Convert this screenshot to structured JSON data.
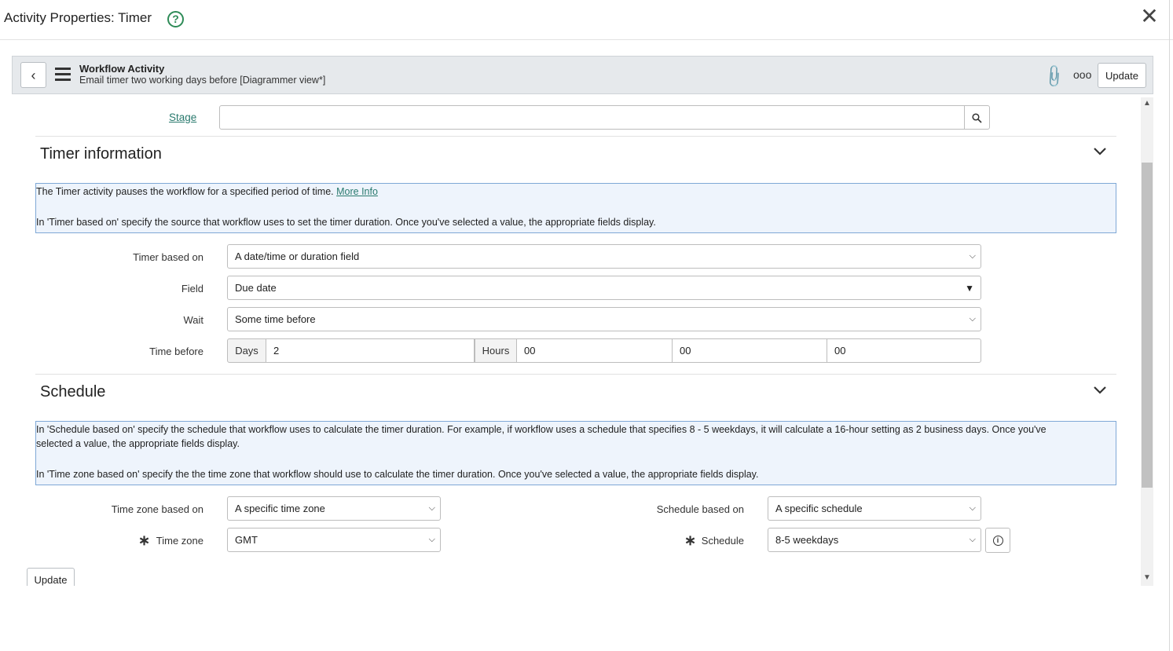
{
  "dialog": {
    "title": "Activity Properties: Timer",
    "help_symbol": "?",
    "close_symbol": "✕"
  },
  "header": {
    "back_symbol": "‹",
    "title": "Workflow Activity",
    "subtitle": "Email timer two working days before [Diagrammer view*]",
    "attach_symbol": "📎",
    "more_symbol": "ooo",
    "update_label": "Update"
  },
  "stage": {
    "label": "Stage",
    "value": "",
    "search_symbol": "🔍"
  },
  "timer": {
    "section_title": "Timer information",
    "info_line1": "The Timer activity pauses the workflow for a specified period of time.",
    "info_link": "More Info",
    "info_line2": "In 'Timer based on' specify the source that workflow uses to set the timer duration. Once you've selected a value, the appropriate fields display.",
    "timer_based_on_label": "Timer based on",
    "timer_based_on_value": "A date/time or duration field",
    "field_label": "Field",
    "field_value": "Due date",
    "wait_label": "Wait",
    "wait_value": "Some time before",
    "time_before_label": "Time before",
    "days_label": "Days",
    "days_value": "2",
    "hours_label": "Hours",
    "hours_value": "00",
    "minutes_value": "00",
    "seconds_value": "00"
  },
  "schedule": {
    "section_title": "Schedule",
    "info_line1": "In 'Schedule based on' specify the schedule that workflow uses to calculate the timer duration. For example, if workflow uses a schedule that specifies 8 - 5 weekdays, it will calculate a 16-hour setting as 2 business days. Once you've",
    "info_line1b": "selected a value, the appropriate fields display.",
    "info_line2": "In 'Time zone based on' specify the the time zone that workflow should use to calculate the timer duration. Once you've selected a value, the appropriate fields display.",
    "tz_based_on_label": "Time zone based on",
    "tz_based_on_value": "A specific time zone",
    "tz_label": "Time zone",
    "tz_value": "GMT",
    "schedule_based_on_label": "Schedule based on",
    "schedule_based_on_value": "A specific schedule",
    "schedule_label": "Schedule",
    "schedule_value": "8-5 weekdays",
    "required_symbol": "∗"
  },
  "footer": {
    "update_label": "Update"
  }
}
